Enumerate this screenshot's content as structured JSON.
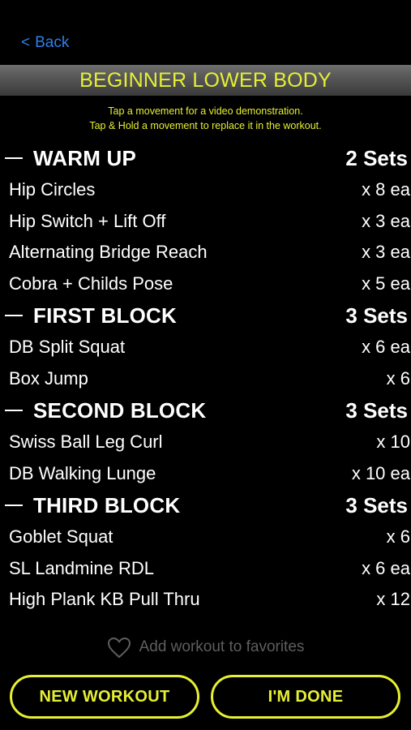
{
  "nav": {
    "back_chevron": "<",
    "back_label": "Back"
  },
  "header": {
    "title": "BEGINNER LOWER BODY",
    "subtitle_line1": "Tap a movement for a video demonstration.",
    "subtitle_line2": "Tap & Hold a movement to replace it in the workout."
  },
  "sections": [
    {
      "title": "WARM UP",
      "sets": "2 Sets",
      "exercises": [
        {
          "name": "Hip Circles",
          "reps": "x 8 ea"
        },
        {
          "name": "Hip Switch + Lift Off",
          "reps": "x 3 ea"
        },
        {
          "name": "Alternating Bridge Reach",
          "reps": "x 3 ea"
        },
        {
          "name": "Cobra + Childs Pose",
          "reps": "x 5 ea"
        }
      ]
    },
    {
      "title": "FIRST BLOCK",
      "sets": "3 Sets",
      "exercises": [
        {
          "name": "DB Split Squat",
          "reps": "x 6 ea"
        },
        {
          "name": "Box Jump",
          "reps": "x 6"
        }
      ]
    },
    {
      "title": "SECOND BLOCK",
      "sets": "3 Sets",
      "exercises": [
        {
          "name": "Swiss Ball Leg Curl",
          "reps": "x 10"
        },
        {
          "name": "DB Walking Lunge",
          "reps": "x 10 ea"
        }
      ]
    },
    {
      "title": "THIRD BLOCK",
      "sets": "3 Sets",
      "exercises": [
        {
          "name": "Goblet Squat",
          "reps": "x 6"
        },
        {
          "name": "SL Landmine RDL",
          "reps": "x 6 ea"
        },
        {
          "name": "High Plank KB Pull Thru",
          "reps": "x 12"
        }
      ]
    }
  ],
  "favorites": {
    "icon": "heart-outline-icon",
    "label": "Add workout to favorites"
  },
  "buttons": {
    "new_workout": "NEW WORKOUT",
    "done": "I'M DONE"
  },
  "colors": {
    "accent_yellow": "#e6f032",
    "link_blue": "#2f7fe6",
    "background": "#000000",
    "muted_gray": "#5e5e5e"
  }
}
